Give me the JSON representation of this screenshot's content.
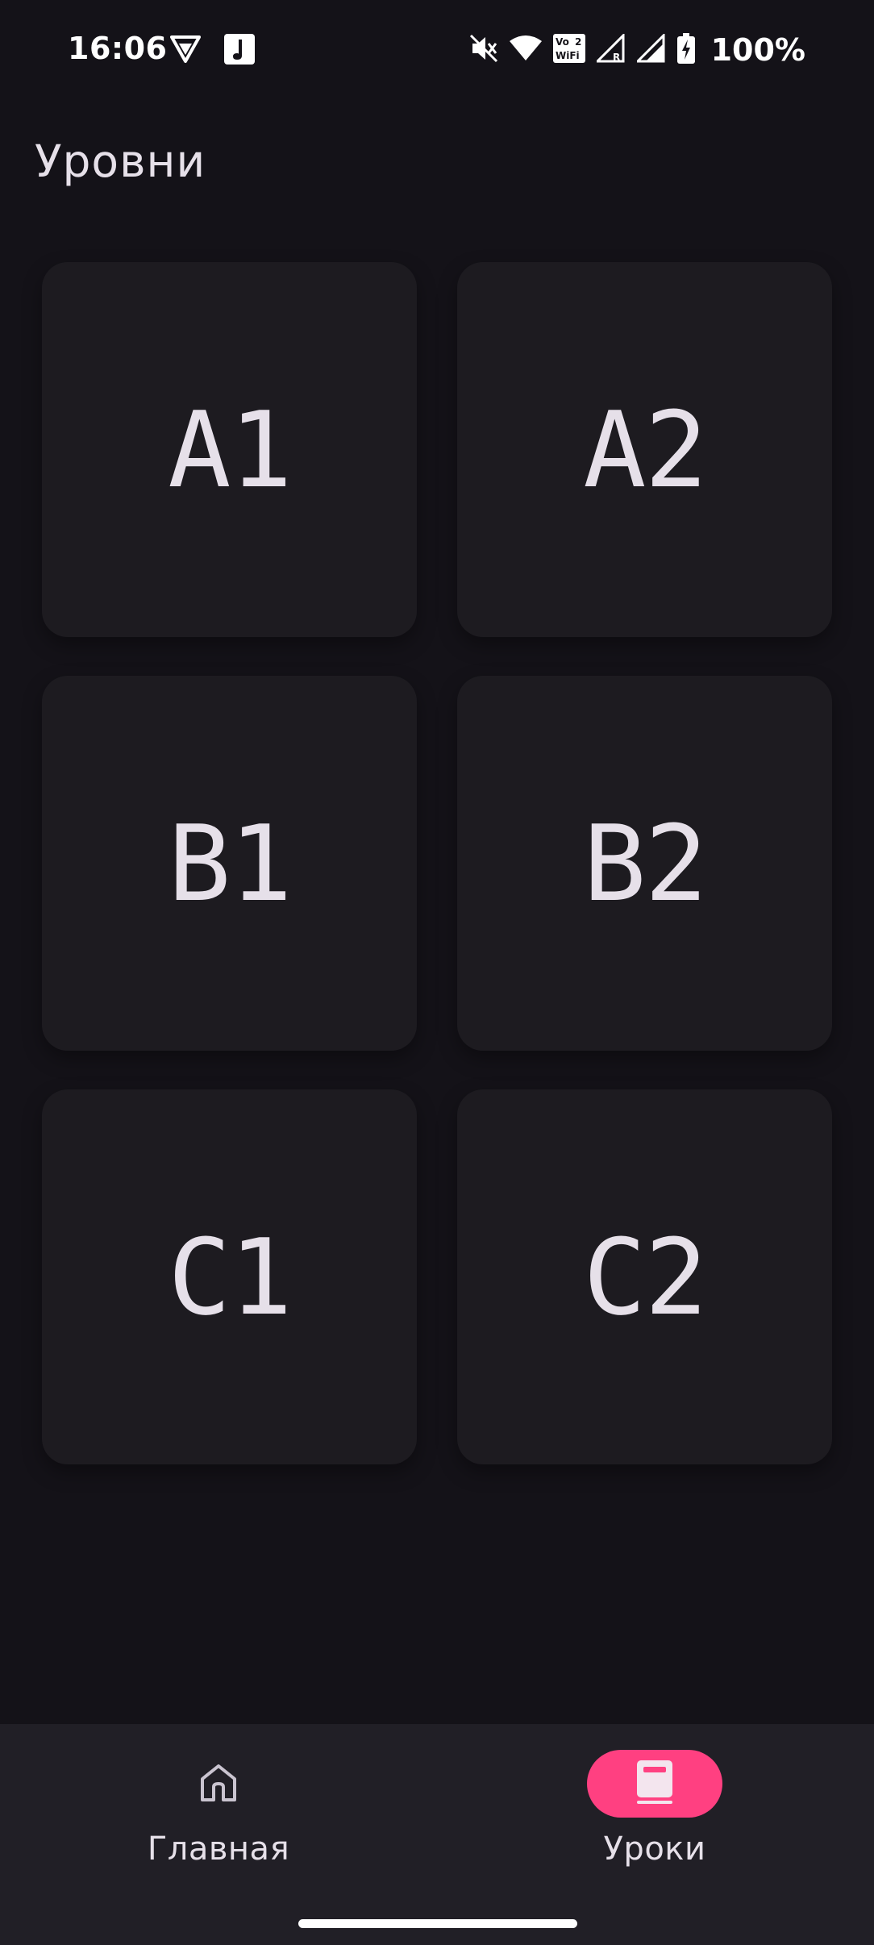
{
  "status_bar": {
    "time": "16:06",
    "battery": "100%",
    "wifi_badge_top": "Vo",
    "wifi_badge_num": "2",
    "wifi_badge_bottom": "WiFi",
    "roaming": "R"
  },
  "header": {
    "title": "Уровни"
  },
  "levels": [
    {
      "label": "A1"
    },
    {
      "label": "A2"
    },
    {
      "label": "B1"
    },
    {
      "label": "B2"
    },
    {
      "label": "C1"
    },
    {
      "label": "C2"
    }
  ],
  "bottom_nav": {
    "items": [
      {
        "label": "Главная",
        "icon": "home-icon",
        "selected": false
      },
      {
        "label": "Уроки",
        "icon": "book-icon",
        "selected": true
      }
    ]
  },
  "colors": {
    "background": "#141218",
    "card": "#1d1b20",
    "nav_background": "#211f26",
    "accent": "#ff4081",
    "text": "#e6e0e9"
  }
}
